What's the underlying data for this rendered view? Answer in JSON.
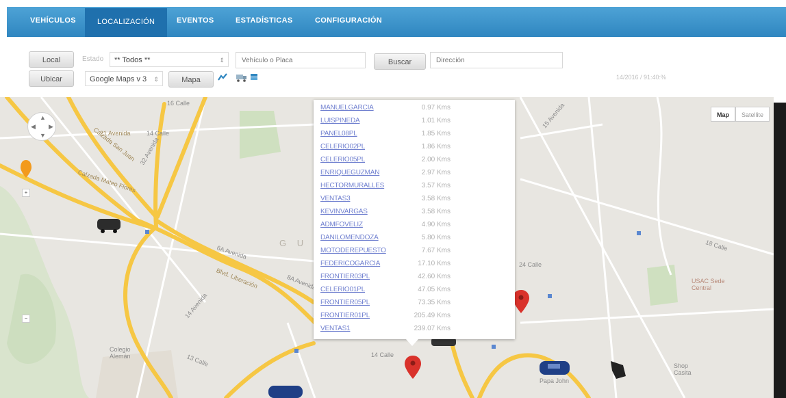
{
  "nav": {
    "tabs": [
      {
        "label": "VEHÍCULOS"
      },
      {
        "label": "LOCALIZACIÓN"
      },
      {
        "label": "EVENTOS"
      },
      {
        "label": "ESTADÍSTICAS"
      },
      {
        "label": "CONFIGURACIÓN"
      }
    ],
    "active_tab": "LOCALIZACIÓN"
  },
  "toolbar": {
    "local_label": "Local",
    "ubicar_label": "Ubicar",
    "estado_label": "Estado",
    "estado_value": "** Todos **",
    "search_placeholder": "Vehículo o Placa",
    "buscar_label": "Buscar",
    "second_input_placeholder": "Dirección",
    "map_provider_value": "Google Maps v 3",
    "mapa_label": "Mapa",
    "timestamp": "14/2016 / 91:40:% "
  },
  "map": {
    "type_map_label": "Map",
    "type_sat_label": "Satellite",
    "labels": {
      "calle16": "16 Calle",
      "ave21": "21 Avenida",
      "calle14": "14 Calle",
      "calzada": "Calzada San Juan",
      "calzada_mateo": "Calzada Mateo Flores",
      "ave32": "32 Avenida",
      "guate": "G U A",
      "ave6a": "6A Avenida",
      "ave8a": "8A Avenida",
      "blvd": "Blvd. Liberación",
      "ave14": "14 Avenida",
      "calle13": "13 Calle",
      "colegio": "Colegio Alemán",
      "calle14b": "14 Calle",
      "calle24": "24 Calle",
      "calle18": "18 Calle",
      "ave15": "15 Avenida",
      "usac": "USAC Sede Central",
      "papa_john": "Papa John",
      "shop": "Shop Casita"
    }
  },
  "popup": {
    "rows": [
      {
        "name": "MANUELGARCIA",
        "distance": "0.97 Kms"
      },
      {
        "name": "LUISPINEDA",
        "distance": "1.01 Kms"
      },
      {
        "name": "PANEL08PL",
        "distance": "1.85 Kms"
      },
      {
        "name": "CELERIO02PL",
        "distance": "1.86 Kms"
      },
      {
        "name": "CELERIO05PL",
        "distance": "2.00 Kms"
      },
      {
        "name": "ENRIQUEGUZMAN",
        "distance": "2.97 Kms"
      },
      {
        "name": "HECTORMURALLES",
        "distance": "3.57 Kms"
      },
      {
        "name": "VENTAS3",
        "distance": "3.58 Kms"
      },
      {
        "name": "KEVINVARGAS",
        "distance": "3.58 Kms"
      },
      {
        "name": "ADMFOVELIZ",
        "distance": "4.90 Kms"
      },
      {
        "name": "DANILOMENDOZA",
        "distance": "5.80 Kms"
      },
      {
        "name": "MOTODEREPUESTO",
        "distance": "7.67 Kms"
      },
      {
        "name": "FEDERICOGARCIA",
        "distance": "17.10 Kms"
      },
      {
        "name": "FRONTIER03PL",
        "distance": "42.60 Kms"
      },
      {
        "name": "CELERIO01PL",
        "distance": "47.05 Kms"
      },
      {
        "name": "FRONTIER05PL",
        "distance": "73.35 Kms"
      },
      {
        "name": "FRONTIER01PL",
        "distance": "205.49 Kms"
      },
      {
        "name": "VENTAS1",
        "distance": "239.07 Kms"
      }
    ]
  },
  "colors": {
    "nav_bg": "#3a95cf",
    "nav_active": "#1f70ad",
    "link": "#6f7fcf",
    "road": "#f6c744",
    "pin": "#d9322b"
  },
  "icons": [
    "chart-icon",
    "truck-icon",
    "flag-icon",
    "pin-icon",
    "vehicle-icon"
  ]
}
